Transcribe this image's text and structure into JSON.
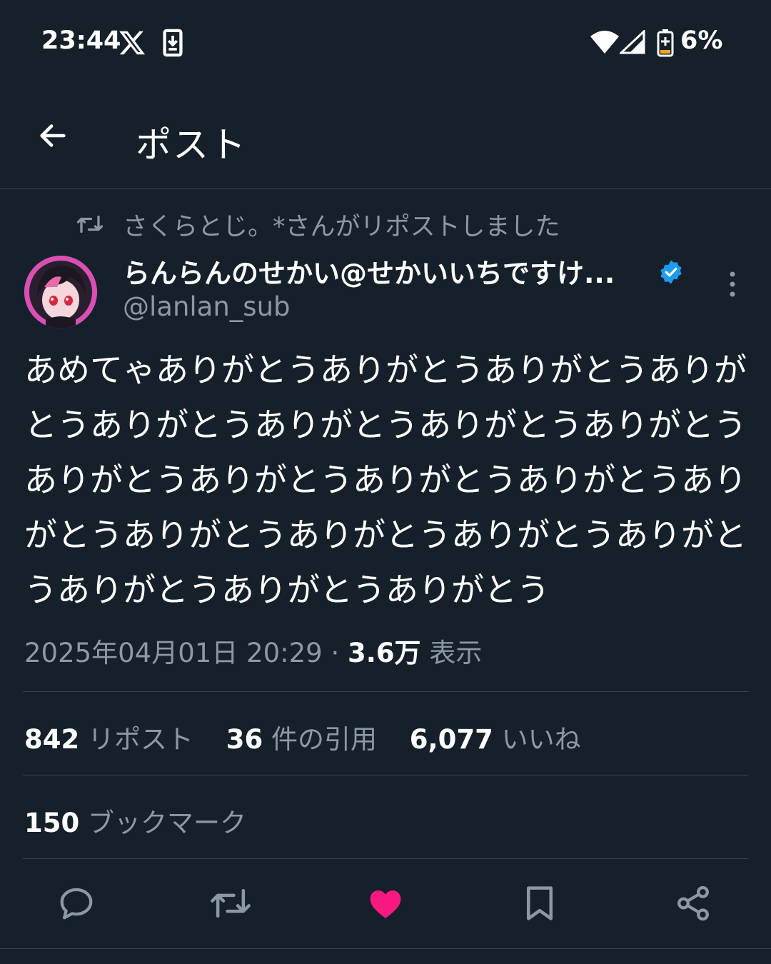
{
  "status_bar": {
    "time": "23:44",
    "battery_percent": "6%",
    "icons": [
      "x-logo-icon",
      "download-icon",
      "wifi-icon",
      "signal-icon",
      "battery-icon"
    ]
  },
  "header": {
    "title": "ポスト",
    "back_icon": "arrow-left-icon"
  },
  "repost": {
    "text": "さくらとじ。*さんがリポストしました",
    "icon": "repost-icon"
  },
  "author": {
    "name": "らんらんのせかい@せかいいちですけ...",
    "handle": "@lanlan_sub",
    "verified": true,
    "verified_color": "#1d9bf0"
  },
  "tweet": {
    "text": "あめてゃありがとうありがとうありがとうありがとうありがとうありがとうありがとうありがとうありがとうありがとうありがとうありがとうありがとうありがとうありがとうありがとうありがとうありがとうありがとうありがとう"
  },
  "meta": {
    "datetime": "2025年04月01日 20:29",
    "separator": "·",
    "views_count": "3.6万",
    "views_label": "表示"
  },
  "stats": {
    "reposts_count": "842",
    "reposts_label": "リポスト",
    "quotes_count": "36",
    "quotes_label": "件の引用",
    "likes_count": "6,077",
    "likes_label": "いいね",
    "bookmarks_count": "150",
    "bookmarks_label": "ブックマーク"
  },
  "actions": {
    "items": [
      "reply-icon",
      "repost-icon",
      "like-icon",
      "bookmark-icon",
      "share-icon"
    ],
    "like_active_color": "#f91880",
    "icon_color": "#8b98a5"
  },
  "colors": {
    "background": "#15202b",
    "secondary_text": "#8b98a5",
    "divider": "#38444d"
  }
}
